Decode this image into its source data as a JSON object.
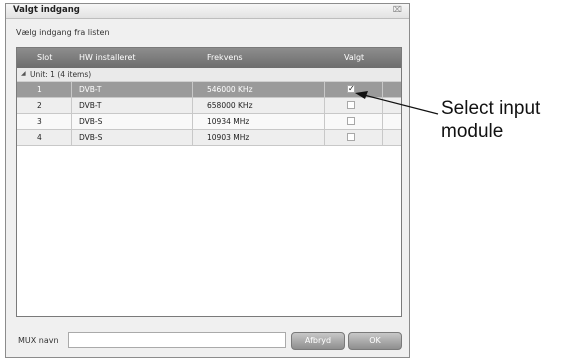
{
  "dialog": {
    "title": "Valgt indgang",
    "close_icon": "⌧",
    "subtitle": "Vælg indgang fra listen"
  },
  "grid": {
    "columns": [
      "Slot",
      "HW installeret",
      "Frekvens",
      "Valgt"
    ],
    "group_label": "Unit: 1 (4 items)",
    "group_icon": "◢",
    "rows": [
      {
        "slot": "1",
        "hw": "DVB-T",
        "freq": "546000 KHz",
        "checked": true
      },
      {
        "slot": "2",
        "hw": "DVB-T",
        "freq": "658000 KHz",
        "checked": false
      },
      {
        "slot": "3",
        "hw": "DVB-S",
        "freq": "10934 MHz",
        "checked": false
      },
      {
        "slot": "4",
        "hw": "DVB-S",
        "freq": "10903 MHz",
        "checked": false
      }
    ],
    "check_mark": "✓"
  },
  "footer": {
    "mux_label": "MUX navn",
    "mux_value": "",
    "cancel_label": "Afbryd",
    "ok_label": "OK"
  },
  "callout": {
    "line1": "Select input",
    "line2": "module"
  }
}
